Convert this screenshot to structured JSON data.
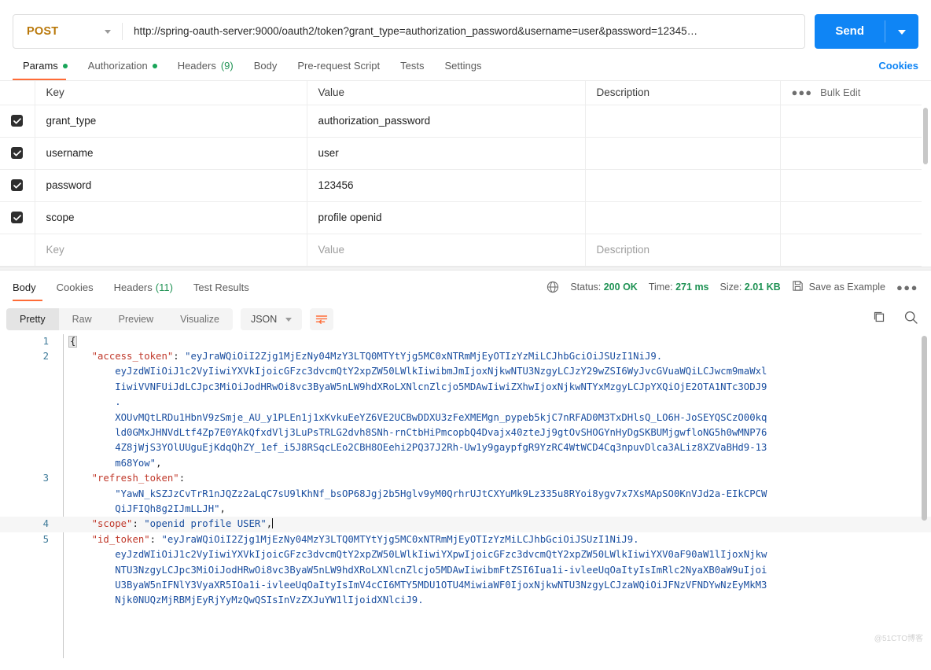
{
  "request": {
    "method": "POST",
    "method_caret": "chevron-down",
    "url": "http://spring-oauth-server:9000/oauth2/token?grant_type=authorization_password&username=user&password=12345…",
    "send_label": "Send",
    "tabs": [
      {
        "label": "Params",
        "dot": true,
        "active": true
      },
      {
        "label": "Authorization",
        "dot": true,
        "active": false
      },
      {
        "label": "Headers",
        "count": "(9)",
        "active": false
      },
      {
        "label": "Body",
        "active": false
      },
      {
        "label": "Pre-request Script",
        "active": false
      },
      {
        "label": "Tests",
        "active": false
      },
      {
        "label": "Settings",
        "active": false
      }
    ],
    "cookies_link": "Cookies"
  },
  "params": {
    "headers": [
      "Key",
      "Value",
      "Description"
    ],
    "bulk_edit": "Bulk Edit",
    "rows": [
      {
        "checked": true,
        "key": "grant_type",
        "value": "authorization_password",
        "description": ""
      },
      {
        "checked": true,
        "key": "username",
        "value": "user",
        "description": ""
      },
      {
        "checked": true,
        "key": "password",
        "value": "123456",
        "description": ""
      },
      {
        "checked": true,
        "key": "scope",
        "value": "profile openid",
        "description": ""
      }
    ],
    "placeholder_row": {
      "key": "Key",
      "value": "Value",
      "description": "Description"
    }
  },
  "response": {
    "tabs": [
      {
        "label": "Body",
        "active": true
      },
      {
        "label": "Cookies",
        "active": false
      },
      {
        "label": "Headers",
        "count": "(11)",
        "active": false
      },
      {
        "label": "Test Results",
        "active": false
      }
    ],
    "status_label": "Status:",
    "status_value": "200 OK",
    "time_label": "Time:",
    "time_value": "271 ms",
    "size_label": "Size:",
    "size_value": "2.01 KB",
    "save_as_example": "Save as Example",
    "view_modes": [
      {
        "label": "Pretty",
        "active": true
      },
      {
        "label": "Raw",
        "active": false
      },
      {
        "label": "Preview",
        "active": false
      },
      {
        "label": "Visualize",
        "active": false
      }
    ],
    "format": "JSON",
    "watermark": "@51CTO博客"
  },
  "body_lines": [
    {
      "num": "1",
      "segments": [
        {
          "t": "brace",
          "v": "{"
        }
      ]
    },
    {
      "num": "2",
      "segments": [
        {
          "t": "indent",
          "v": "    "
        },
        {
          "t": "key",
          "v": "\"access_token\""
        },
        {
          "t": "punct",
          "v": ": "
        },
        {
          "t": "str",
          "v": "\"eyJraWQiOiI2Zjg1MjEzNy04MzY3LTQ0MTYtYjg5MC0xNTRmMjEyOTIzYzMiLCJhbGciOiJSUzI1NiJ9."
        }
      ]
    },
    {
      "num": "",
      "segments": [
        {
          "t": "indent",
          "v": "        "
        },
        {
          "t": "str",
          "v": "eyJzdWIiOiJ1c2VyIiwiYXVkIjoicGFzc3dvcmQtY2xpZW50LWlkIiwibmJmIjoxNjkwNTU3NzgyLCJzY29wZSI6WyJvcGVuaWQiLCJwcm9maWxl"
        }
      ]
    },
    {
      "num": "",
      "segments": [
        {
          "t": "indent",
          "v": "        "
        },
        {
          "t": "str",
          "v": "IiwiVVNFUiJdLCJpc3MiOiJodHRwOi8vc3ByaW5nLW9hdXRoLXNlcnZlcjo5MDAwIiwiZXhwIjoxNjkwNTYxMzgyLCJpYXQiOjE2OTA1NTc3ODJ9"
        }
      ]
    },
    {
      "num": "",
      "segments": [
        {
          "t": "indent",
          "v": "        "
        },
        {
          "t": "str",
          "v": "."
        }
      ]
    },
    {
      "num": "",
      "segments": [
        {
          "t": "indent",
          "v": "        "
        },
        {
          "t": "str",
          "v": "XOUvMQtLRDu1HbnV9zSmje_AU_y1PLEn1j1xKvkuEeYZ6VE2UCBwDDXU3zFeXMEMgn_pypeb5kjC7nRFAD0M3TxDHlsQ_LO6H-JoSEYQSCzO00kq"
        }
      ]
    },
    {
      "num": "",
      "segments": [
        {
          "t": "indent",
          "v": "        "
        },
        {
          "t": "str",
          "v": "ld0GMxJHNVdLtf4Zp7E0YAkQfxdVlj3LuPsTRLG2dvh8SNh-rnCtbHiPmcopbQ4Dvajx40zteJj9gtOvSHOGYnHyDgSKBUMjgwfloNG5h0wMNP76"
        }
      ]
    },
    {
      "num": "",
      "segments": [
        {
          "t": "indent",
          "v": "        "
        },
        {
          "t": "str",
          "v": "4Z8jWjS3YOlUUguEjKdqQhZY_1ef_i5J8RSqcLEo2CBH8OEehi2PQ37J2Rh-Uw1y9gaypfgR9YzRC4WtWCD4Cq3npuvDlca3ALiz8XZVaBHd9-13"
        }
      ]
    },
    {
      "num": "",
      "segments": [
        {
          "t": "indent",
          "v": "        "
        },
        {
          "t": "str",
          "v": "m68Yow\""
        },
        {
          "t": "punct",
          "v": ","
        }
      ]
    },
    {
      "num": "3",
      "segments": [
        {
          "t": "indent",
          "v": "    "
        },
        {
          "t": "key",
          "v": "\"refresh_token\""
        },
        {
          "t": "punct",
          "v": ":"
        }
      ]
    },
    {
      "num": "",
      "segments": [
        {
          "t": "indent",
          "v": "        "
        },
        {
          "t": "str",
          "v": "\"YawN_kSZJzCvTrR1nJQZz2aLqC7sU9lKhNf_bsOP68Jgj2b5Hglv9yM0QrhrUJtCXYuMk9Lz335u8RYoi8ygv7x7XsMApSO0KnVJd2a-EIkCPCW"
        }
      ]
    },
    {
      "num": "",
      "segments": [
        {
          "t": "indent",
          "v": "        "
        },
        {
          "t": "str",
          "v": "QiJFIQh8g2IJmLLJH\""
        },
        {
          "t": "punct",
          "v": ","
        }
      ]
    },
    {
      "num": "4",
      "hl": true,
      "segments": [
        {
          "t": "indent",
          "v": "    "
        },
        {
          "t": "key",
          "v": "\"scope\""
        },
        {
          "t": "punct",
          "v": ": "
        },
        {
          "t": "str",
          "v": "\"openid profile USER\""
        },
        {
          "t": "punct",
          "v": ","
        },
        {
          "t": "cursor",
          "v": ""
        }
      ]
    },
    {
      "num": "5",
      "segments": [
        {
          "t": "indent",
          "v": "    "
        },
        {
          "t": "key",
          "v": "\"id_token\""
        },
        {
          "t": "punct",
          "v": ": "
        },
        {
          "t": "str",
          "v": "\"eyJraWQiOiI2Zjg1MjEzNy04MzY3LTQ0MTYtYjg5MC0xNTRmMjEyOTIzYzMiLCJhbGciOiJSUzI1NiJ9."
        }
      ]
    },
    {
      "num": "",
      "segments": [
        {
          "t": "indent",
          "v": "        "
        },
        {
          "t": "str",
          "v": "eyJzdWIiOiJ1c2VyIiwiYXVkIjoicGFzc3dvcmQtY2xpZW50LWlkIiwiYXpwIjoicGFzc3dvcmQtY2xpZW50LWlkIiwiYXV0aF90aW1lIjoxNjkw"
        }
      ]
    },
    {
      "num": "",
      "segments": [
        {
          "t": "indent",
          "v": "        "
        },
        {
          "t": "str",
          "v": "NTU3NzgyLCJpc3MiOiJodHRwOi8vc3ByaW5nLW9hdXRoLXNlcnZlcjo5MDAwIiwibmFtZSI6Iua1i-ivleeUqOaItyIsImRlc2NyaXB0aW9uIjoi"
        }
      ]
    },
    {
      "num": "",
      "segments": [
        {
          "t": "indent",
          "v": "        "
        },
        {
          "t": "str",
          "v": "U3ByaW5nIFNlY3VyaXR5IOa1i-ivleeUqOaItyIsImV4cCI6MTY5MDU1OTU4MiwiaWF0IjoxNjkwNTU3NzgyLCJzaWQiOiJFNzVFNDYwNzEyMkM3"
        }
      ]
    },
    {
      "num": "",
      "segments": [
        {
          "t": "indent",
          "v": "        "
        },
        {
          "t": "str",
          "v": "Njk0NUQzMjRBMjEyRjYyMzQwQSIsInVzZXJuYW1lIjoidXNlciJ9."
        }
      ]
    }
  ]
}
